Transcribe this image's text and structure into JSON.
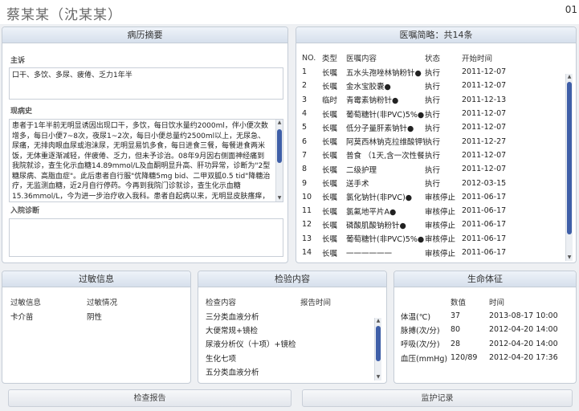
{
  "header": {
    "patient_name": "蔡某某（沈某某）",
    "patient_id": "01"
  },
  "history": {
    "title": "病历摘要",
    "chief_complaint_label": "主诉",
    "chief_complaint": "口干、多饮、多尿、疲倦、乏力1年半",
    "present_illness_label": "现病史",
    "present_illness": "患者于1年半前无明显诱因出现口干，多饮，每日饮水量约2000ml，伴小便次数增多，每日小便7~8次，夜尿1~2次，每日小便总量约2500ml以上，无尿急、尿痛，无排肉眼血尿或泡沫尿，无明显易饥多食，每日进食三餐，每餐进食两米饭，无体重逐渐减轻，伴疲倦、乏力，但未予诊治。08年9月因右侧面神经痛到我院就诊，查生化示血糖14.89mmol/L及血酮明显升高、肝功异常，诊断为\"2型糖尿病、高脂血症\"。此后患者自行服\"优降糖5mg bid、二甲双胍0.5 tid\"降糖治疗，无监测血糖，近2月自行停药。今再到我院门诊就诊，查生化示血糖15.36mmol/L，今为进一步治疗收入我科。患者自起病以来，无明显皮肤瘙痒，无头晕、无头痛、无畏寒发热，无心前区压榨样疼痛，无胸闷、无气",
    "admission_diag_label": "入院诊断",
    "admission_diag": ""
  },
  "orders": {
    "title": "医嘱简略：共14条",
    "columns": [
      "NO.",
      "类型",
      "医嘱内容",
      "状态",
      "开始时间"
    ],
    "rows": [
      [
        "1",
        "长嘱",
        "五水头孢唑林钠粉针●",
        "执行",
        "2011-12-07"
      ],
      [
        "2",
        "长嘱",
        "金水宝胶囊●",
        "执行",
        "2011-12-07"
      ],
      [
        "3",
        "临时",
        "青霉素钠粉针●",
        "执行",
        "2011-12-13"
      ],
      [
        "4",
        "长嘱",
        "葡萄糖针(非PVC)5%●",
        "执行",
        "2011-12-07"
      ],
      [
        "5",
        "长嘱",
        "低分子量肝素钠针●",
        "执行",
        "2011-12-07"
      ],
      [
        "6",
        "长嘱",
        "阿莫西林钠克拉维酸钾针",
        "执行",
        "2011-12-27"
      ],
      [
        "7",
        "长嘱",
        "普食 （1天,含一次性餐具）",
        "执行",
        "2011-12-07"
      ],
      [
        "8",
        "长嘱",
        "二级护理",
        "执行",
        "2011-12-07"
      ],
      [
        "9",
        "长嘱",
        "送手术",
        "执行",
        "2012-03-15"
      ],
      [
        "10",
        "长嘱",
        "氯化钠针(非PVC)●",
        "审核停止",
        "2011-06-17"
      ],
      [
        "11",
        "长嘱",
        "氯氟地平片A●",
        "审核停止",
        "2011-06-17"
      ],
      [
        "12",
        "长嘱",
        "磷酸肌酸钠粉针●",
        "审核停止",
        "2011-06-17"
      ],
      [
        "13",
        "长嘱",
        "葡萄糖针(非PVC)5%●",
        "审核停止",
        "2011-06-17"
      ],
      [
        "14",
        "长嘱",
        "一一一一一一",
        "审核停止",
        "2011-06-17"
      ]
    ]
  },
  "allergy": {
    "title": "过敏信息",
    "columns": [
      "过敏信息",
      "过敏情况"
    ],
    "rows": [
      [
        "卡介苗",
        "阴性"
      ]
    ]
  },
  "exams": {
    "title": "检验内容",
    "columns": [
      "检查内容",
      "报告时间"
    ],
    "rows": [
      [
        "三分类血液分析",
        ""
      ],
      [
        "大便常规+镜检",
        ""
      ],
      [
        "尿液分析仪（十项）+镜检",
        ""
      ],
      [
        "生化七项",
        ""
      ],
      [
        "五分类血液分析",
        ""
      ]
    ]
  },
  "vitals": {
    "title": "生命体征",
    "columns": [
      "",
      "数值",
      "时间"
    ],
    "rows": [
      [
        "体温(℃)",
        "37",
        "2013-08-17 10:00"
      ],
      [
        "脉搏(次/分)",
        "80",
        "2012-04-20 14:00"
      ],
      [
        "呼吸(次/分)",
        "28",
        "2012-04-20 14:00"
      ],
      [
        "血压(mmHg)",
        "120/89",
        "2012-04-20 17:36"
      ]
    ]
  },
  "buttons": {
    "exam_report": "检查报告",
    "monitor_record": "监护记录"
  },
  "colors": {
    "panel_header": "#d6e0ec",
    "scroll_thumb": "#3f5fa8"
  }
}
